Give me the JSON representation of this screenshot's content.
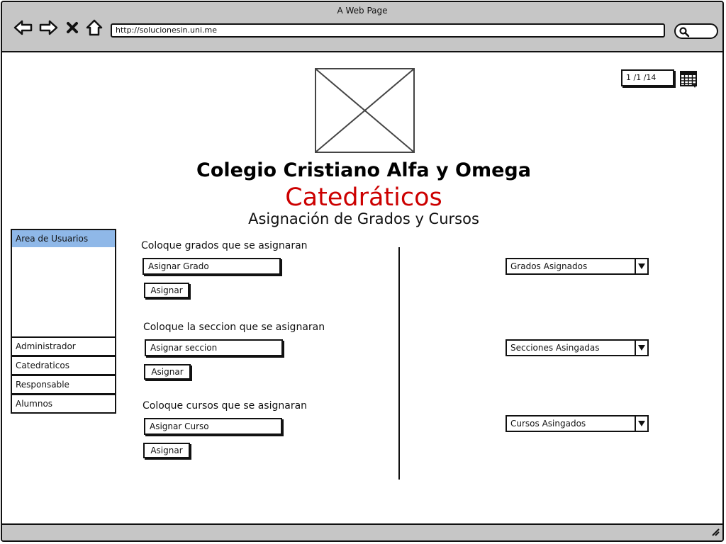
{
  "window": {
    "title": "A Web Page"
  },
  "browser": {
    "url": "http://solucionesin.uni.me",
    "icons": [
      "back-arrow-icon",
      "forward-arrow-icon",
      "stop-icon",
      "home-icon",
      "search-icon",
      "resize-grip-icon"
    ]
  },
  "header": {
    "school_name": "Colegio Cristiano Alfa y Omega",
    "page_title": "Catedráticos",
    "page_subtitle": "Asignación de Grados y Cursos",
    "pager": "1 /1  /14",
    "accent_color": "#cc0000"
  },
  "sidebar": {
    "header": "Area de Usuarios",
    "header_color": "#8fb8e8",
    "items": [
      {
        "label": "Administrador"
      },
      {
        "label": "Catedraticos"
      },
      {
        "label": "Responsable"
      },
      {
        "label": "Alumnos"
      }
    ]
  },
  "form": {
    "grado": {
      "label": "Coloque grados que se asignaran",
      "input_value": "Asignar Grado",
      "button": "Asignar",
      "dropdown": "Grados Asignados"
    },
    "seccion": {
      "label": "Coloque la seccion que se asignaran",
      "input_value": "Asignar seccion",
      "button": "Asignar",
      "dropdown": "Secciones Asingadas"
    },
    "curso": {
      "label": "Coloque cursos que se asignaran",
      "input_value": "Asignar Curso",
      "button": "Asignar",
      "dropdown": "Cursos Asingados"
    }
  }
}
